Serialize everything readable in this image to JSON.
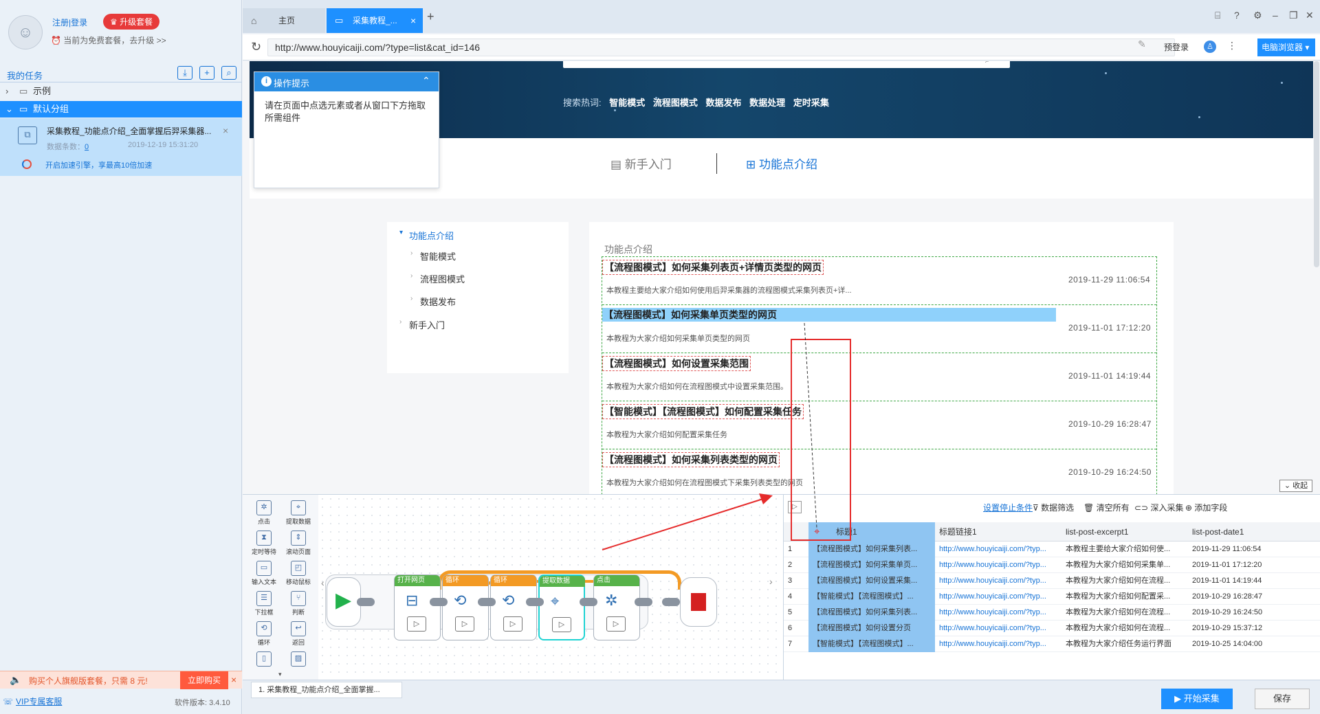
{
  "sidebar": {
    "login": "注册|登录",
    "upgrade": "升级套餐",
    "plan_text": "当前为免费套餐，去升级 >>",
    "tasks_title": "我的任务",
    "tree": [
      {
        "label": "示例"
      },
      {
        "label": "默认分组"
      }
    ],
    "task": {
      "title": "采集教程_功能点介绍_全面掌握后羿采集器...",
      "count_label": "数据条数：",
      "count": "0",
      "date": "2019-12-19 15:31:20",
      "accel": "开启加速引擎，享最高10倍加速"
    },
    "promo": {
      "text": "购买个人旗舰版套餐，只需 8 元!",
      "buy": "立即购买"
    },
    "vip": "VIP专属客服",
    "version": "软件版本: 3.4.10"
  },
  "tabs": [
    {
      "label": "主页"
    },
    {
      "label": "采集教程_..."
    }
  ],
  "address": {
    "url": "http://www.houyicaiji.com/?type=list&cat_id=146",
    "prelogin": "预登录",
    "mode": "电脑浏览器"
  },
  "web": {
    "hot_label": "搜索热词:",
    "hot_words": [
      "智能模式",
      "流程图模式",
      "数据发布",
      "数据处理",
      "定时采集"
    ],
    "nav1": "新手入门",
    "nav2": "功能点介绍",
    "tip": {
      "title": "操作提示",
      "body": "请在页面中点选元素或者从窗口下方拖取所需组件"
    },
    "leftnav": {
      "active": "功能点介绍",
      "items": [
        "智能模式",
        "流程图模式",
        "数据发布"
      ],
      "last": "新手入门"
    },
    "section_title": "功能点介绍",
    "articles": [
      {
        "title": "【流程图模式】如何采集列表页+详情页类型的网页",
        "excerpt": "本教程主要给大家介绍如何使用后羿采集器的流程图模式采集列表页+详...",
        "date": "2019-11-29 11:06:54"
      },
      {
        "title": "【流程图模式】如何采集单页类型的网页",
        "excerpt": "本教程为大家介绍如何采集单页类型的网页",
        "date": "2019-11-01 17:12:20"
      },
      {
        "title": "【流程图模式】如何设置采集范围",
        "excerpt": "本教程为大家介绍如何在流程图模式中设置采集范围。",
        "date": "2019-11-01 14:19:44"
      },
      {
        "title": "【智能模式】【流程图模式】如何配置采集任务",
        "excerpt": "本教程为大家介绍如何配置采集任务",
        "date": "2019-10-29 16:28:47"
      },
      {
        "title": "【流程图模式】如何采集列表类型的网页",
        "excerpt": "本教程为大家介绍如何在流程图模式下采集列表类型的网页",
        "date": "2019-10-29 16:24:50"
      }
    ],
    "collapse": "收起"
  },
  "palette": [
    {
      "label": "点击",
      "icon": "click-icon"
    },
    {
      "label": "提取数据",
      "icon": "extract-icon"
    },
    {
      "label": "定时等待",
      "icon": "hourglass-icon"
    },
    {
      "label": "滚动页面",
      "icon": "scroll-icon"
    },
    {
      "label": "输入文本",
      "icon": "text-input-icon"
    },
    {
      "label": "移动鼠标",
      "icon": "mouse-icon"
    },
    {
      "label": "下拉框",
      "icon": "dropdown-icon"
    },
    {
      "label": "判断",
      "icon": "branch-icon"
    },
    {
      "label": "循环",
      "icon": "loop-icon"
    },
    {
      "label": "返回",
      "icon": "back-icon"
    }
  ],
  "flow_nodes": [
    {
      "label": "打开网页"
    },
    {
      "label": "循环"
    },
    {
      "label": "循环"
    },
    {
      "label": "提取数据"
    },
    {
      "label": "点击"
    }
  ],
  "grid": {
    "toolbar": {
      "stop": "设置停止条件",
      "filter": "数据筛选",
      "clear": "清空所有",
      "deep": "深入采集",
      "add": "添加字段"
    },
    "headers": [
      "标题1",
      "标题链接1",
      "list-post-excerpt1",
      "list-post-date1"
    ],
    "rows": [
      [
        "1",
        "【流程图模式】如何采集列表...",
        "http://www.houyicaiji.com/?typ...",
        "本教程主要给大家介绍如何使...",
        "2019-11-29 11:06:54"
      ],
      [
        "2",
        "【流程图模式】如何采集单页...",
        "http://www.houyicaiji.com/?typ...",
        "本教程为大家介绍如何采集单...",
        "2019-11-01 17:12:20"
      ],
      [
        "3",
        "【流程图模式】如何设置采集...",
        "http://www.houyicaiji.com/?typ...",
        "本教程为大家介绍如何在流程...",
        "2019-11-01 14:19:44"
      ],
      [
        "4",
        "【智能模式】【流程图模式】...",
        "http://www.houyicaiji.com/?typ...",
        "本教程为大家介绍如何配置采...",
        "2019-10-29 16:28:47"
      ],
      [
        "5",
        "【流程图模式】如何采集列表...",
        "http://www.houyicaiji.com/?typ...",
        "本教程为大家介绍如何在流程...",
        "2019-10-29 16:24:50"
      ],
      [
        "6",
        "【流程图模式】如何设置分页",
        "http://www.houyicaiji.com/?typ...",
        "本教程为大家介绍如何在流程...",
        "2019-10-29 15:37:12"
      ],
      [
        "7",
        "【智能模式】【流程图模式】...",
        "http://www.houyicaiji.com/?typ...",
        "本教程为大家介绍任务运行界面",
        "2019-10-25 14:04:00"
      ]
    ]
  },
  "footer": {
    "task_tab": "1. 采集教程_功能点介绍_全面掌握...",
    "start": "开始采集",
    "save": "保存"
  },
  "colors": {
    "accent": "#1e90ff",
    "promo": "#ff5a3d",
    "highlight": "#8fd1fb",
    "annotation": "#e52b2b"
  }
}
